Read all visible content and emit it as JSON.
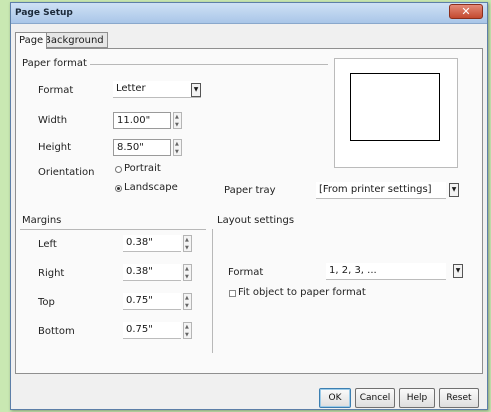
{
  "window": {
    "title": "Page Setup",
    "close_glyph": "✕"
  },
  "tabs": [
    {
      "label": "Page",
      "active": true
    },
    {
      "label": "Background",
      "active": false
    }
  ],
  "paper_format": {
    "title": "Paper format",
    "format_label": "Format",
    "format_value": "Letter",
    "width_label": "Width",
    "width_value": "11.00\"",
    "height_label": "Height",
    "height_value": "8.50\"",
    "orientation_label": "Orientation",
    "portrait_label": "Portrait",
    "landscape_label": "Landscape",
    "selected_orientation": "Landscape"
  },
  "paper_tray": {
    "label": "Paper tray",
    "value": "[From printer settings]"
  },
  "margins": {
    "title": "Margins",
    "left_label": "Left",
    "left_value": "0.38\"",
    "right_label": "Right",
    "right_value": "0.38\"",
    "top_label": "Top",
    "top_value": "0.75\"",
    "bottom_label": "Bottom",
    "bottom_value": "0.75\""
  },
  "layout_settings": {
    "title": "Layout settings",
    "format_label": "Format",
    "format_value": "1, 2, 3, ...",
    "fit_label": "Fit object to paper format",
    "fit_checked": false
  },
  "buttons": {
    "ok": "OK",
    "cancel": "Cancel",
    "help": "Help",
    "reset": "Reset"
  },
  "colors": {
    "background": "#c9e8b2",
    "title_bar": "#a9c6e8",
    "close_button": "#c34a30"
  }
}
